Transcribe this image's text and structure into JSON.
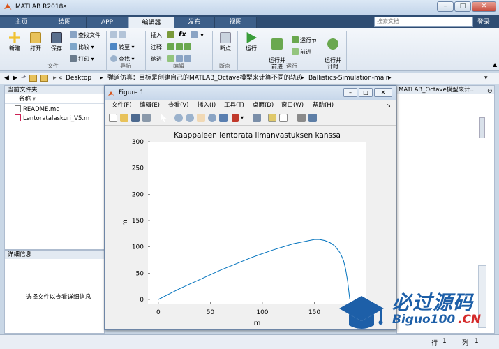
{
  "window": {
    "title": "MATLAB R2018a",
    "controls": [
      "–",
      "□",
      "✕"
    ]
  },
  "tabs": [
    {
      "label": "主页",
      "active": false
    },
    {
      "label": "绘图",
      "active": false
    },
    {
      "label": "APP",
      "active": false
    },
    {
      "label": "编辑器",
      "active": true
    },
    {
      "label": "发布",
      "active": false
    },
    {
      "label": "视图",
      "active": false
    }
  ],
  "search": {
    "placeholder": "搜索文档"
  },
  "signin": "登录",
  "toolstrip": {
    "file": {
      "new": "新建",
      "open": "打开",
      "save": "保存",
      "find_files": "查找文件",
      "compare": "比较",
      "print": "打印",
      "group": "文件"
    },
    "nav": {
      "goto": "转至",
      "find": "查找",
      "group": "导航"
    },
    "edit": {
      "insert": "插入",
      "comment": "注释",
      "indent": "缩进",
      "fx": "fx",
      "group": "编辑"
    },
    "breakpoints": {
      "label": "断点",
      "group": "断点"
    },
    "run": {
      "run": "运行",
      "run_advance": "运行并\n前进",
      "run_section": "运行节",
      "advance": "前进",
      "run_time": "运行并\n计时",
      "group": "运行"
    }
  },
  "address": {
    "path": [
      "Desktop",
      "弹道仿真：目标是创建自己的MATLAB_Octave模型来计算不同的轨迹",
      "Ballistics-Simulation-main"
    ]
  },
  "current_folder": {
    "title": "当前文件夹",
    "column": "名称",
    "files": [
      "README.md",
      "Lentoratalaskuri_V5.m"
    ]
  },
  "details": {
    "title": "详细信息",
    "message": "选择文件以查看详细信息"
  },
  "right_panel_header": "MATLAB_Octave模型来计...",
  "statusbar": {
    "row_label": "行",
    "row_value": "1",
    "col_label": "列",
    "col_value": "1"
  },
  "figure": {
    "title": "Figure 1",
    "menu": [
      "文件(F)",
      "编辑(E)",
      "查看(V)",
      "插入(I)",
      "工具(T)",
      "桌面(D)",
      "窗口(W)",
      "帮助(H)"
    ]
  },
  "chart_data": {
    "type": "line",
    "title": "Kaappaleen lentorata ilmanvastuksen kanssa",
    "xlabel": "m",
    "ylabel": "m",
    "xlim": [
      -10,
      200
    ],
    "ylim": [
      -8,
      300
    ],
    "xticks": [
      0,
      50,
      100,
      150,
      200
    ],
    "yticks": [
      0,
      50,
      100,
      150,
      200,
      250,
      300
    ],
    "series": [
      {
        "x": [
          0,
          10,
          20,
          30,
          40,
          50,
          60,
          70,
          80,
          90,
          100,
          110,
          120,
          130,
          140,
          150,
          155,
          160,
          165,
          170,
          175,
          178,
          180,
          182,
          184
        ],
        "y": [
          0,
          10,
          20,
          29,
          38,
          47,
          56,
          64,
          72,
          80,
          87,
          94,
          100,
          106,
          110,
          114,
          114,
          112,
          108,
          101,
          88,
          74,
          58,
          34,
          0
        ]
      }
    ]
  },
  "watermark": {
    "text_cn": "必过源码",
    "text_en": "Biguo100",
    "text_suffix": ".CN"
  }
}
